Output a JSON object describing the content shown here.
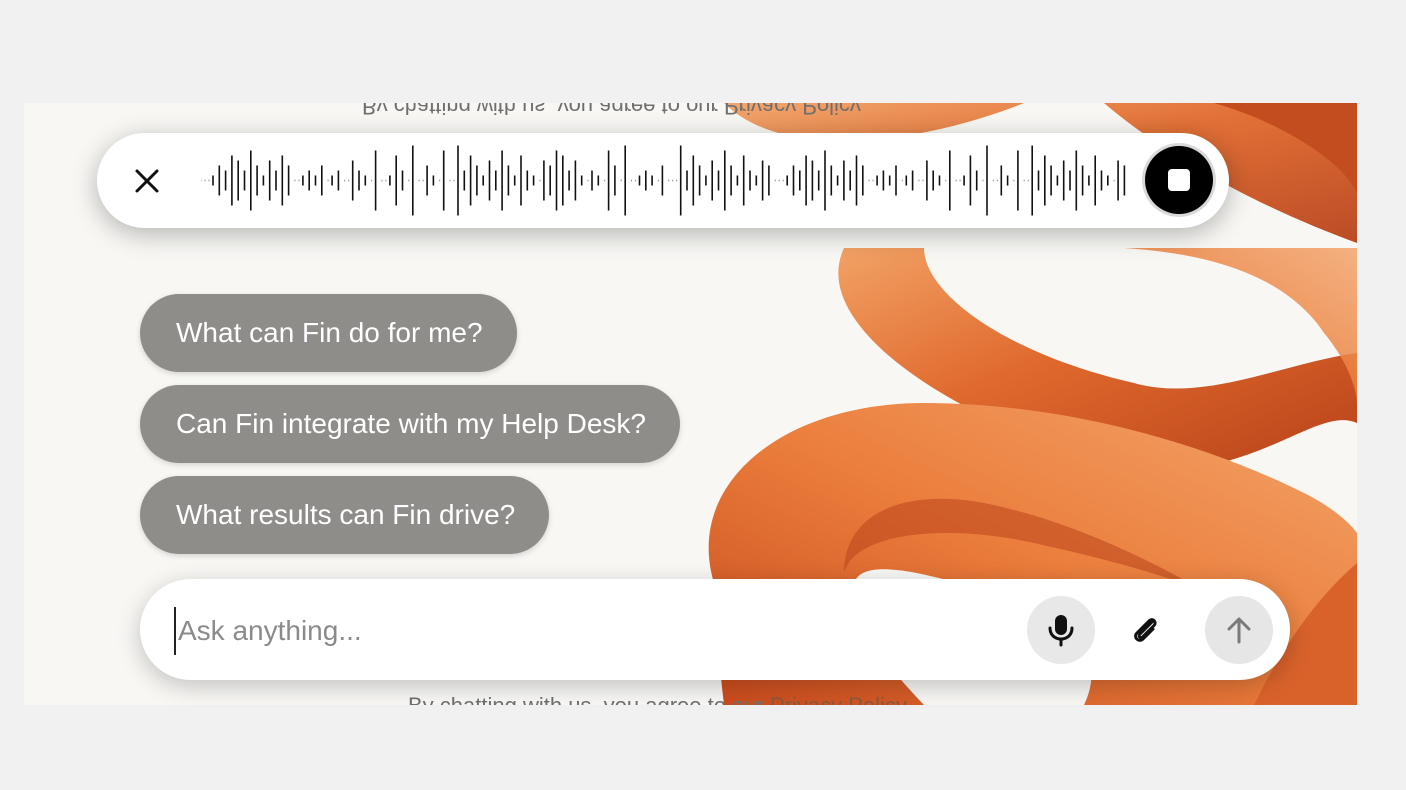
{
  "privacy": {
    "text": "By chatting with us, you agree to our ",
    "link": "Privacy Policy"
  },
  "voice": {
    "close_icon": "close-icon",
    "stop_icon": "stop-icon"
  },
  "suggestions": [
    "What can Fin do for me?",
    "Can Fin integrate with my Help Desk?",
    "What results can Fin drive?"
  ],
  "composer": {
    "placeholder": "Ask anything...",
    "mic_icon": "microphone-icon",
    "attach_icon": "paperclip-icon",
    "send_icon": "arrow-up-icon"
  },
  "colors": {
    "accent_orange": "#d9622b",
    "suggestion_bg": "#8f8d8a",
    "stop_button": "#000000"
  }
}
